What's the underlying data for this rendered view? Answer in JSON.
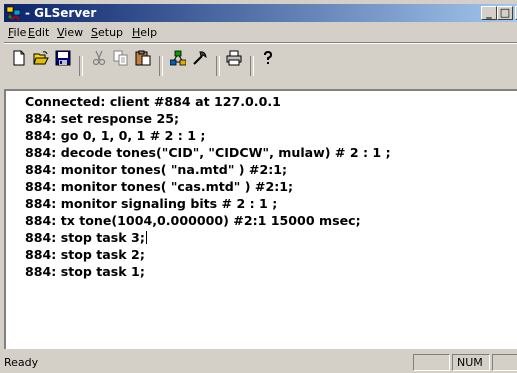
{
  "window": {
    "title": "- GLServer",
    "caption_buttons": {
      "minimize": "_",
      "maximize": "□",
      "close": "X"
    }
  },
  "menubar": {
    "items": [
      {
        "label": "File",
        "accel": "F",
        "rest": "ile"
      },
      {
        "label": "Edit",
        "accel": "E",
        "rest": "dit"
      },
      {
        "label": "View",
        "accel": "V",
        "rest": "iew"
      },
      {
        "label": "Setup",
        "accel": "S",
        "rest": "etup"
      },
      {
        "label": "Help",
        "accel": "H",
        "rest": "elp"
      }
    ]
  },
  "toolbar": {
    "buttons": [
      "new-icon",
      "open-icon",
      "save-icon",
      "cut-icon",
      "copy-icon",
      "paste-icon",
      "network-icon",
      "tool-icon",
      "print-icon",
      "help-icon"
    ]
  },
  "log": {
    "lines": [
      "Connected: client #884 at 127.0.0.1",
      "884: set response 25;",
      "884: go 0, 1, 0, 1 # 2 : 1 ;",
      "884: decode tones(\"CID\", \"CIDCW\", mulaw) # 2 : 1 ;",
      "884: monitor tones( \"na.mtd\" ) #2:1;",
      "884: monitor tones( \"cas.mtd\" ) #2:1;",
      "884: monitor signaling bits # 2 : 1 ;",
      "884: tx tone(1004,0.000000) #2:1 15000 msec;",
      "884: stop task 3;",
      "884: stop task 2;",
      "884: stop task 1;"
    ]
  },
  "statusbar": {
    "text": "Ready",
    "panes": [
      "",
      "NUM",
      ""
    ]
  },
  "colors": {
    "titlebar_start": "#0a246a",
    "titlebar_end": "#a6caf0",
    "face": "#d4d0c8",
    "client_bg": "#ffffff",
    "desktop": "#3a6ea5"
  }
}
